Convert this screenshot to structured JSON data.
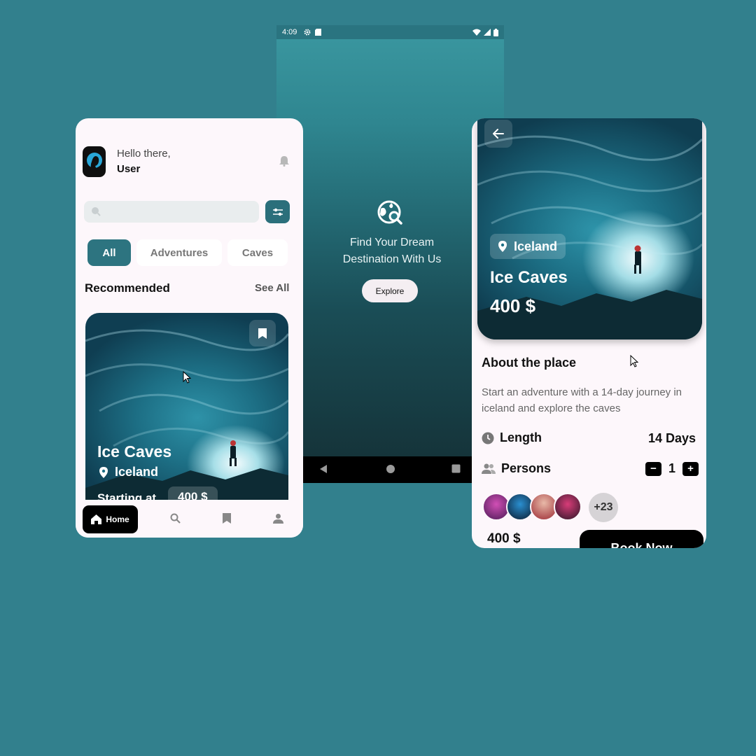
{
  "splash": {
    "status_time": "4:09",
    "tagline_line1": "Find Your Dream",
    "tagline_line2": "Destination With Us",
    "explore_label": "Explore"
  },
  "home": {
    "greeting": "Hello there,",
    "username": "User",
    "search_placeholder": "",
    "chips": [
      "All",
      "Adventures",
      "Caves"
    ],
    "recommended_title": "Recommended",
    "see_all_label": "See All",
    "card": {
      "title": "Ice Caves",
      "location": "Iceland",
      "starting_label": "Starting at",
      "price": "400 $"
    },
    "nav_home_label": "Home"
  },
  "details": {
    "location": "Iceland",
    "title": "Ice Caves",
    "price": "400 $",
    "about_title": "About the place",
    "description": "Start an adventure with a 14-day journey in iceland and explore the caves",
    "length_label": "Length",
    "length_value": "14 Days",
    "persons_label": "Persons",
    "persons_count": "1",
    "minus_label": "−",
    "plus_label": "+",
    "more_people": "+23",
    "total_price": "400 $",
    "book_label": "Book Now"
  },
  "colors": {
    "background": "#32808d",
    "accent": "#2d7480",
    "card_bg": "#fdf7fb",
    "dark_button": "#000000"
  }
}
